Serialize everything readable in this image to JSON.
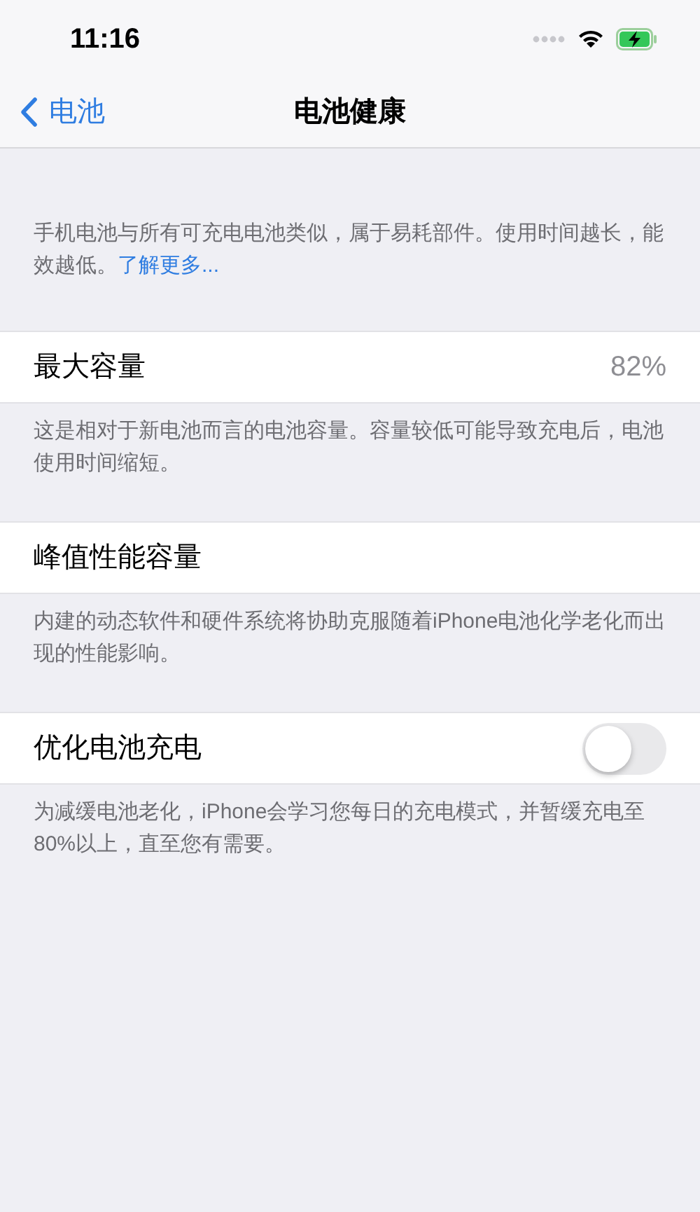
{
  "status_bar": {
    "time": "11:16"
  },
  "nav": {
    "back": "电池",
    "title": "电池健康"
  },
  "intro": {
    "text": "手机电池与所有可充电电池类似，属于易耗部件。使用时间越长，能效越低。",
    "link": "了解更多..."
  },
  "sections": [
    {
      "kind": "value",
      "label": "最大容量",
      "value": "82%",
      "footer": "这是相对于新电池而言的电池容量。容量较低可能导致充电后，电池使用时间缩短。"
    },
    {
      "kind": "plain",
      "label": "峰值性能容量",
      "footer": "内建的动态软件和硬件系统将协助克服随着iPhone电池化学老化而出现的性能影响。"
    },
    {
      "kind": "toggle",
      "label": "优化电池充电",
      "on": false,
      "footer": "为减缓电池老化，iPhone会学习您每日的充电模式，并暂缓充电至80%以上，直至您有需要。"
    }
  ]
}
